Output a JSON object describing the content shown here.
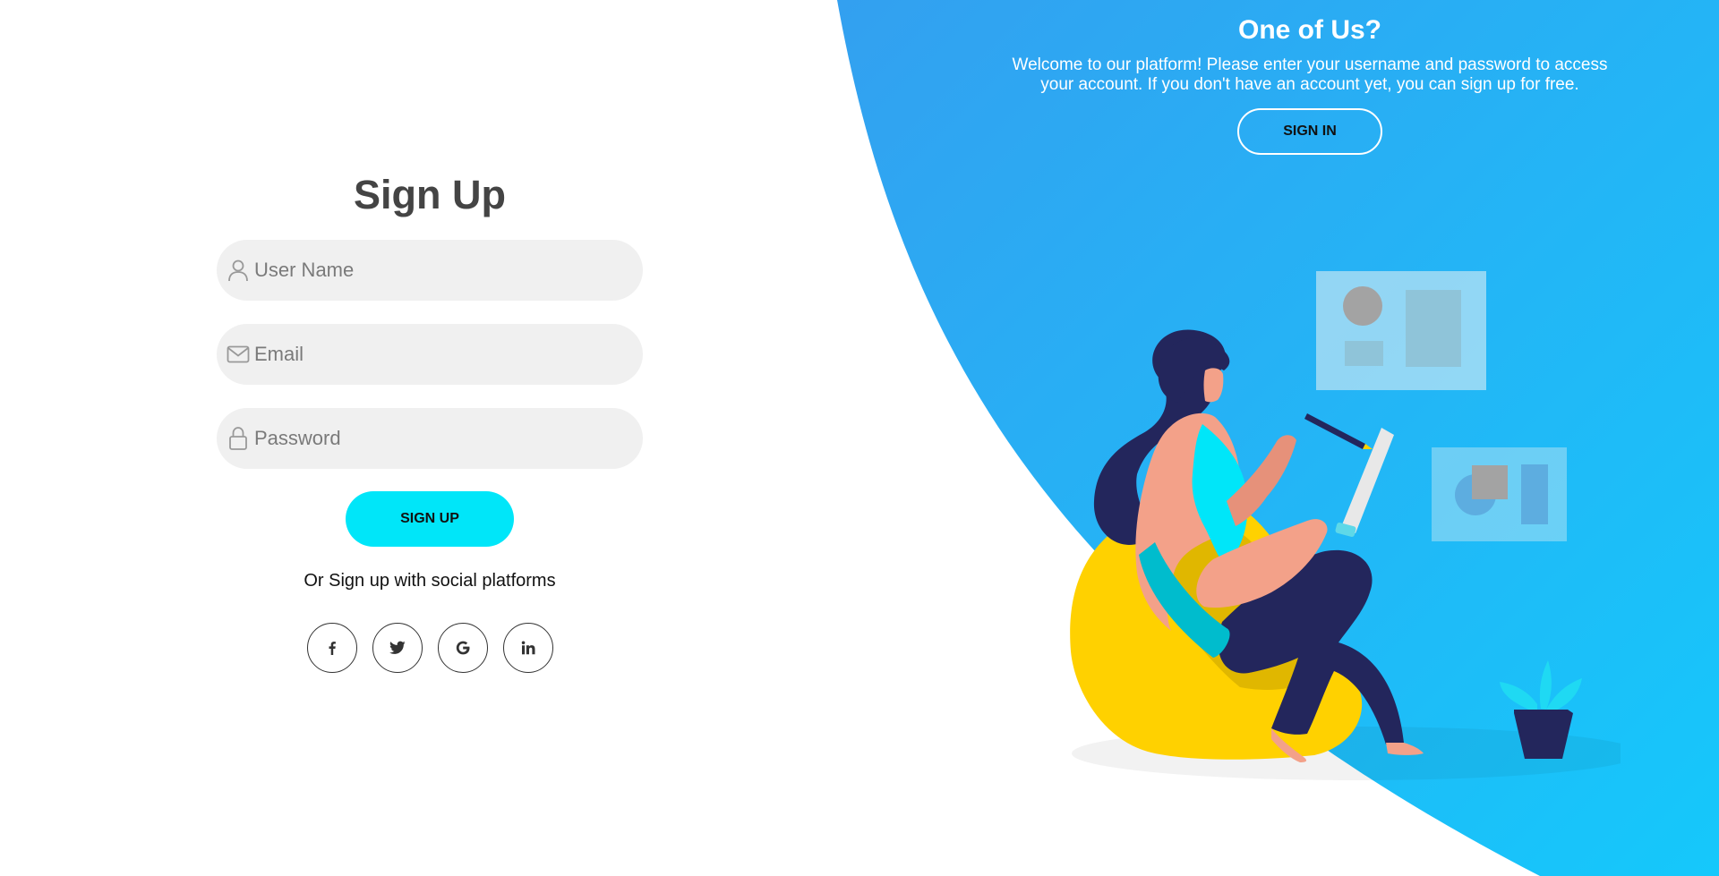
{
  "colors": {
    "accent": "#00e6f9",
    "gradient_start": "#33a0f0",
    "gradient_end": "#15c8fb",
    "input_bg": "#f0f0f0",
    "title": "#444444"
  },
  "signup": {
    "title": "Sign Up",
    "fields": [
      {
        "icon": "user-icon",
        "placeholder": "User Name",
        "value": ""
      },
      {
        "icon": "mail-icon",
        "placeholder": "Email",
        "value": ""
      },
      {
        "icon": "lock-icon",
        "placeholder": "Password",
        "value": ""
      }
    ],
    "submit_label": "SIGN UP",
    "social_text": "Or Sign up with social platforms",
    "social": [
      {
        "icon": "facebook-icon"
      },
      {
        "icon": "twitter-icon"
      },
      {
        "icon": "google-icon"
      },
      {
        "icon": "linkedin-icon"
      }
    ]
  },
  "panel": {
    "title": "One of Us?",
    "text": "Welcome to our platform! Please enter your username and password to access your account. If you don't have an account yet, you can sign up for free.",
    "button_label": "SIGN IN"
  }
}
